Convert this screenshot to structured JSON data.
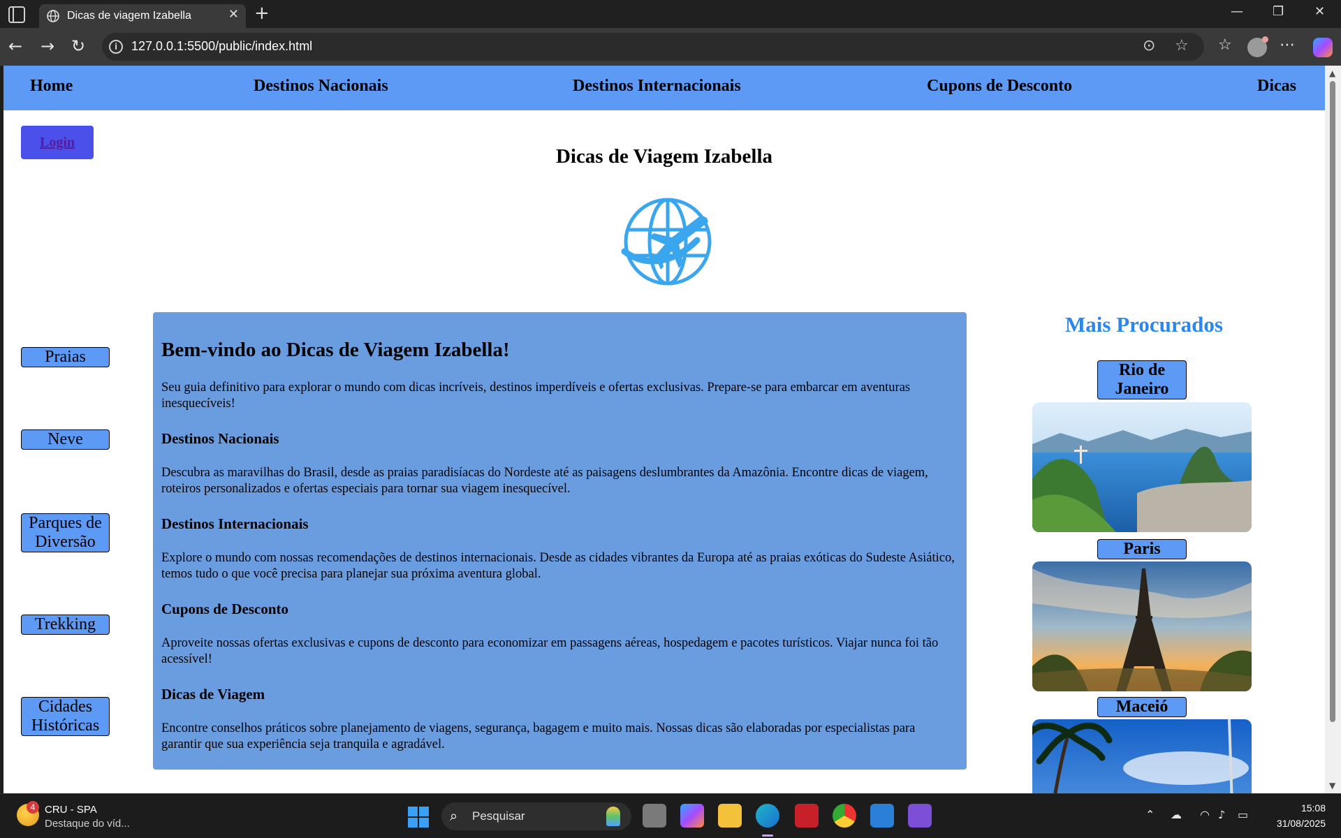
{
  "browser": {
    "tab_title": "Dicas de viagem Izabella",
    "url": "127.0.0.1:5500/public/index.html"
  },
  "nav": {
    "items": [
      {
        "label": "Home"
      },
      {
        "label": "Destinos Nacionais"
      },
      {
        "label": "Destinos Internacionais"
      },
      {
        "label": "Cupons de Desconto"
      },
      {
        "label": "Dicas"
      }
    ]
  },
  "login": {
    "label": "Login"
  },
  "site_title": "Dicas de Viagem Izabella",
  "sidebar": {
    "items": [
      {
        "label": "Praias"
      },
      {
        "label": "Neve"
      },
      {
        "label": "Parques de Diversão"
      },
      {
        "label": "Trekking"
      },
      {
        "label": "Cidades Históricas"
      }
    ]
  },
  "main": {
    "title": "Bem-vindo ao Dicas de Viagem Izabella!",
    "intro": "Seu guia definitivo para explorar o mundo com dicas incríveis, destinos imperdíveis e ofertas exclusivas. Prepare-se para embarcar em aventuras inesquecíveis!",
    "sections": [
      {
        "heading": "Destinos Nacionais",
        "text": "Descubra as maravilhas do Brasil, desde as praias paradisíacas do Nordeste até as paisagens deslumbrantes da Amazônia. Encontre dicas de viagem, roteiros personalizados e ofertas especiais para tornar sua viagem inesquecível."
      },
      {
        "heading": "Destinos Internacionais",
        "text": "Explore o mundo com nossas recomendações de destinos internacionais. Desde as cidades vibrantes da Europa até as praias exóticas do Sudeste Asiático, temos tudo o que você precisa para planejar sua próxima aventura global."
      },
      {
        "heading": "Cupons de Desconto",
        "text": "Aproveite nossas ofertas exclusivas e cupons de desconto para economizar em passagens aéreas, hospedagem e pacotes turísticos. Viajar nunca foi tão acessível!"
      },
      {
        "heading": "Dicas de Viagem",
        "text": "Encontre conselhos práticos sobre planejamento de viagens, segurança, bagagem e muito mais. Nossas dicas são elaboradas por especialistas para garantir que sua experiência seja tranquila e agradável."
      }
    ]
  },
  "popular": {
    "title": "Mais Procurados",
    "items": [
      {
        "label": "Rio de Janeiro"
      },
      {
        "label": "Paris"
      },
      {
        "label": "Maceió"
      }
    ]
  },
  "taskbar": {
    "weather_badge": "4",
    "weather_title": "CRU - SPA",
    "weather_sub": "Destaque do víd...",
    "search_placeholder": "Pesquisar",
    "time": "15:08",
    "date": "31/08/2025"
  },
  "colors": {
    "nav_bg": "#5c9af6",
    "main_box_bg": "#6a9de0",
    "login_bg": "#4b50ea",
    "popular_title": "#2b87f0"
  }
}
